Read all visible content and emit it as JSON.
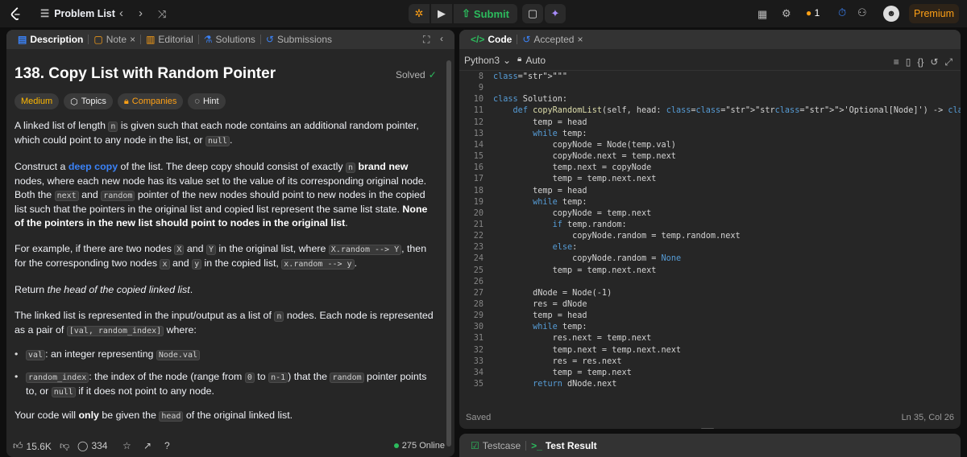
{
  "topbar": {
    "problem_list": "Problem List",
    "submit": "Submit",
    "streak": "1",
    "premium": "Premium"
  },
  "left_tabs": [
    {
      "label": "Description"
    },
    {
      "label": "Note"
    },
    {
      "label": "Editorial"
    },
    {
      "label": "Solutions"
    },
    {
      "label": "Submissions"
    }
  ],
  "problem": {
    "title": "138. Copy List with Random Pointer",
    "status": "Solved",
    "tags": [
      "Medium",
      "Topics",
      "Companies",
      "Hint"
    ],
    "p1": [
      "A linked list of length ",
      "n",
      " is given such that each node contains an additional random pointer, which could point to any node in the list, or ",
      "null",
      "."
    ],
    "p2": [
      "Construct a ",
      "deep copy",
      " of the list. The deep copy should consist of exactly ",
      "n",
      " ",
      "brand new",
      " nodes, where each new node has its value set to the value of its corresponding original node. Both the ",
      "next",
      " and ",
      "random",
      " pointer of the new nodes should point to new nodes in the copied list such that the pointers in the original list and copied list represent the same list state. ",
      "None of the pointers in the new list should point to nodes in the original list",
      "."
    ],
    "p3": [
      "For example, if there are two nodes ",
      "X",
      " and ",
      "Y",
      " in the original list, where ",
      "X.random --> Y",
      ", then for the corresponding two nodes ",
      "x",
      " and ",
      "y",
      " in the copied list, ",
      "x.random --> y",
      "."
    ],
    "p4": [
      "Return ",
      "the head of the copied linked list",
      "."
    ],
    "p5": [
      "The linked list is represented in the input/output as a list of ",
      "n",
      " nodes. Each node is represented as a pair of ",
      "[val, random_index]",
      " where:"
    ],
    "li1": [
      "val",
      ": an integer representing ",
      "Node.val"
    ],
    "li2": [
      "random_index",
      ": the index of the node (range from ",
      "0",
      " to ",
      "n-1",
      ") that the ",
      "random",
      " pointer points to, or ",
      "null",
      " if it does not point to any node."
    ],
    "p6": [
      "Your code will ",
      "only",
      " be given the ",
      "head",
      " of the original linked list."
    ]
  },
  "footer": {
    "likes": "15.6K",
    "comments": "334",
    "online": "275 Online"
  },
  "right_tabs": [
    {
      "label": "Code"
    },
    {
      "label": "Accepted"
    }
  ],
  "editor": {
    "language": "Python3",
    "mode": "Auto",
    "saved": "Saved",
    "cursor": "Ln 35, Col 26",
    "lines": [
      {
        "n": "8",
        "code": "\"\"\""
      },
      {
        "n": "9",
        "code": ""
      },
      {
        "n": "10",
        "code": "class Solution:"
      },
      {
        "n": "11",
        "code": "    def copyRandomList(self, head: 'Optional[Node]') -> 'Optional[Node]':"
      },
      {
        "n": "12",
        "code": "        temp = head"
      },
      {
        "n": "13",
        "code": "        while temp:"
      },
      {
        "n": "14",
        "code": "            copyNode = Node(temp.val)"
      },
      {
        "n": "15",
        "code": "            copyNode.next = temp.next"
      },
      {
        "n": "16",
        "code": "            temp.next = copyNode"
      },
      {
        "n": "17",
        "code": "            temp = temp.next.next"
      },
      {
        "n": "18",
        "code": "        temp = head"
      },
      {
        "n": "19",
        "code": "        while temp:"
      },
      {
        "n": "20",
        "code": "            copyNode = temp.next"
      },
      {
        "n": "21",
        "code": "            if temp.random:"
      },
      {
        "n": "22",
        "code": "                copyNode.random = temp.random.next"
      },
      {
        "n": "23",
        "code": "            else:"
      },
      {
        "n": "24",
        "code": "                copyNode.random = None"
      },
      {
        "n": "25",
        "code": "            temp = temp.next.next"
      },
      {
        "n": "26",
        "code": ""
      },
      {
        "n": "27",
        "code": "        dNode = Node(-1)"
      },
      {
        "n": "28",
        "code": "        res = dNode"
      },
      {
        "n": "29",
        "code": "        temp = head"
      },
      {
        "n": "30",
        "code": "        while temp:"
      },
      {
        "n": "31",
        "code": "            res.next = temp.next"
      },
      {
        "n": "32",
        "code": "            temp.next = temp.next.next"
      },
      {
        "n": "33",
        "code": "            res = res.next"
      },
      {
        "n": "34",
        "code": "            temp = temp.next"
      },
      {
        "n": "35",
        "code": "        return dNode.next"
      }
    ]
  },
  "bottom_tabs": [
    {
      "label": "Testcase"
    },
    {
      "label": "Test Result"
    }
  ]
}
